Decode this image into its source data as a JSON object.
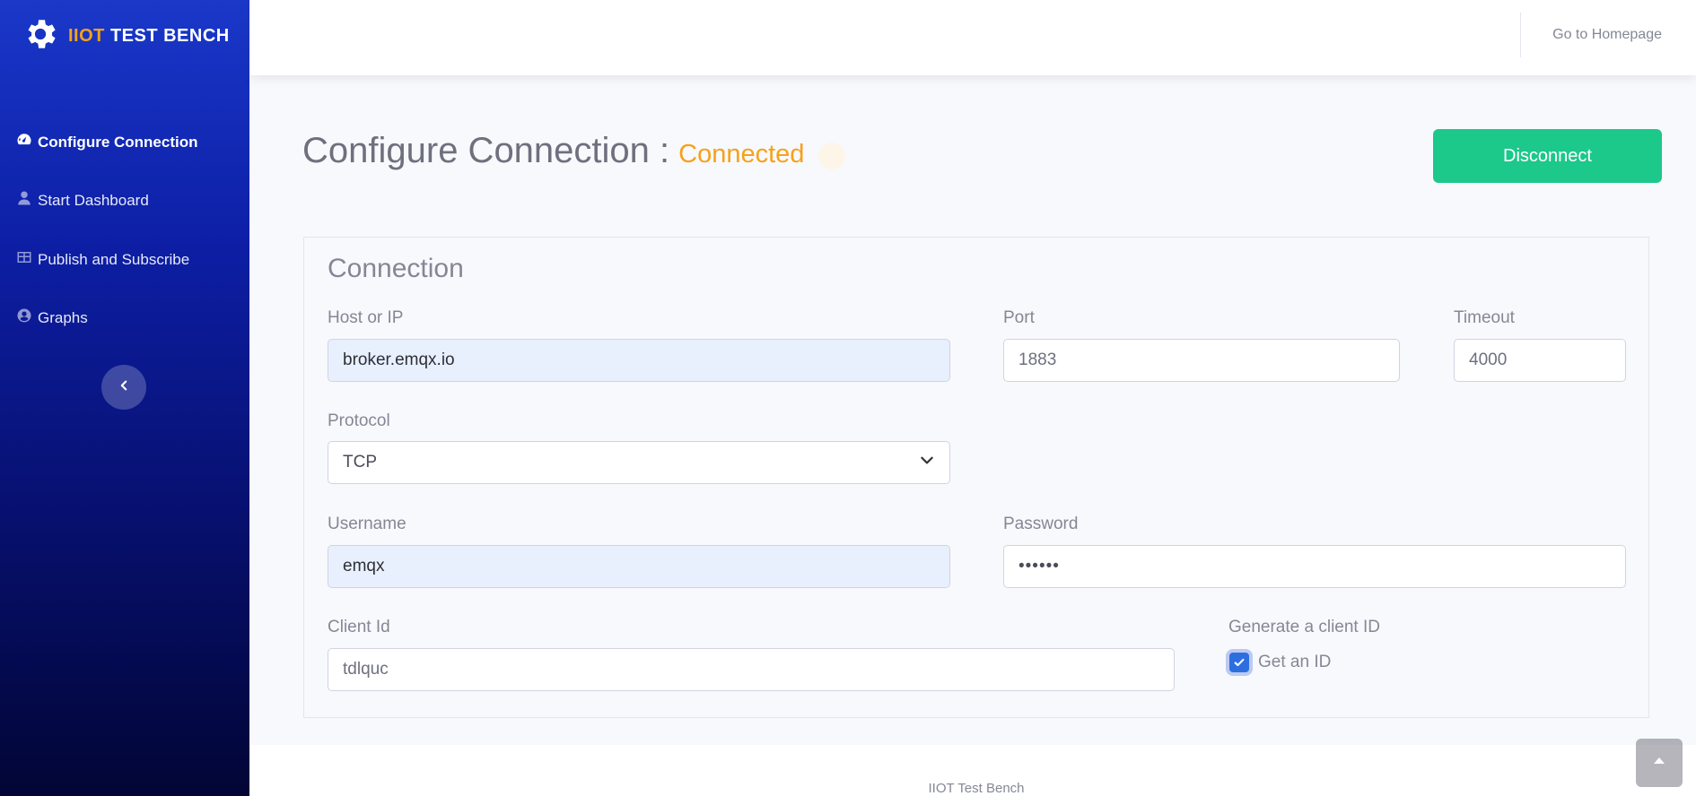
{
  "brand": {
    "highlight": "IIOT",
    "rest": " TEST BENCH",
    "icon": "gear-icon"
  },
  "sidebar": {
    "items": [
      {
        "label": "Configure Connection",
        "icon": "tachometer-icon",
        "active": true
      },
      {
        "label": "Start Dashboard",
        "icon": "user-icon",
        "active": false
      },
      {
        "label": "Publish and Subscribe",
        "icon": "table-icon",
        "active": false
      },
      {
        "label": "Graphs",
        "icon": "user-circle-icon",
        "active": false
      }
    ],
    "toggle_icon": "chevron-left-icon"
  },
  "topbar": {
    "home_link": "Go to Homepage"
  },
  "page": {
    "title": "Configure Connection :",
    "status": "Connected",
    "disconnect_label": "Disconnect"
  },
  "connection": {
    "title": "Connection",
    "host": {
      "label": "Host or IP",
      "value": "broker.emqx.io"
    },
    "port": {
      "label": "Port",
      "value": "1883"
    },
    "timeout": {
      "label": "Timeout",
      "value": "4000"
    },
    "protocol": {
      "label": "Protocol",
      "value": "TCP"
    },
    "username": {
      "label": "Username",
      "value": "emqx"
    },
    "password": {
      "label": "Password",
      "value": "••••••"
    },
    "client_id": {
      "label": "Client Id",
      "value": "tdlquc"
    },
    "generate": {
      "label": "Generate a client ID",
      "checkbox_label": "Get an ID",
      "checked": true
    }
  },
  "footer": {
    "text": "IIOT Test Bench"
  },
  "colors": {
    "accent": "#f6a11b",
    "success": "#1cc88a",
    "sidebar_top": "#1a38c9",
    "sidebar_bottom": "#020535"
  }
}
